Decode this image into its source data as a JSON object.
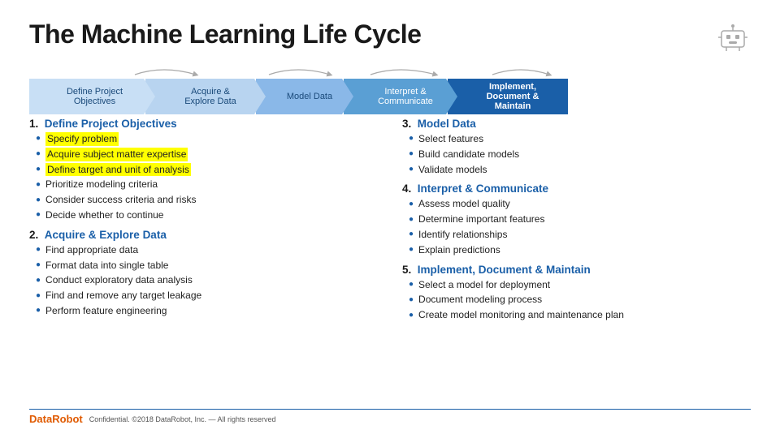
{
  "header": {
    "title": "The Machine Learning Life Cycle"
  },
  "chevrons": [
    {
      "label": "Define Project\nObjectives",
      "shade": 1
    },
    {
      "label": "Acquire &\nExplore Data",
      "shade": 2
    },
    {
      "label": "Model Data",
      "shade": 3
    },
    {
      "label": "Interpret &\nCommunicate",
      "shade": 4
    },
    {
      "label": "Implement,\nDocument &\nMaintain",
      "shade": 5
    }
  ],
  "sections": [
    {
      "number": "1.",
      "title": "Define Project Objectives",
      "items": [
        {
          "text": "Specify problem",
          "highlight": true
        },
        {
          "text": "Acquire subject matter expertise",
          "highlight": true
        },
        {
          "text": "Define target and unit of analysis",
          "highlight": true
        },
        {
          "text": "Prioritize modeling criteria",
          "highlight": false
        },
        {
          "text": "Consider success criteria and risks",
          "highlight": false
        },
        {
          "text": "Decide whether to continue",
          "highlight": false
        }
      ]
    },
    {
      "number": "2.",
      "title": "Acquire & Explore Data",
      "items": [
        {
          "text": "Find appropriate data",
          "highlight": false
        },
        {
          "text": "Format data into single table",
          "highlight": false
        },
        {
          "text": "Conduct exploratory data analysis",
          "highlight": false
        },
        {
          "text": "Find and remove any target leakage",
          "highlight": false
        },
        {
          "text": "Perform feature engineering",
          "highlight": false
        }
      ]
    },
    {
      "number": "3.",
      "title": "Model Data",
      "items": [
        {
          "text": "Select features",
          "highlight": false
        },
        {
          "text": "Build candidate models",
          "highlight": false
        },
        {
          "text": "Validate models",
          "highlight": false
        }
      ]
    },
    {
      "number": "4.",
      "title": "Interpret & Communicate",
      "items": [
        {
          "text": "Assess model quality",
          "highlight": false
        },
        {
          "text": "Determine important features",
          "highlight": false
        },
        {
          "text": "Identify relationships",
          "highlight": false
        },
        {
          "text": "Explain predictions",
          "highlight": false
        }
      ]
    },
    {
      "number": "5.",
      "title": "Implement, Document & Maintain",
      "items": [
        {
          "text": "Select a model for deployment",
          "highlight": false
        },
        {
          "text": "Document modeling process",
          "highlight": false
        },
        {
          "text": "Create model monitoring and maintenance plan",
          "highlight": false
        }
      ]
    }
  ],
  "footer": {
    "brand_data": "Data",
    "brand_robot": "Robot",
    "confidential": "Confidential. ©2018 DataRobot, Inc. — All rights reserved"
  }
}
